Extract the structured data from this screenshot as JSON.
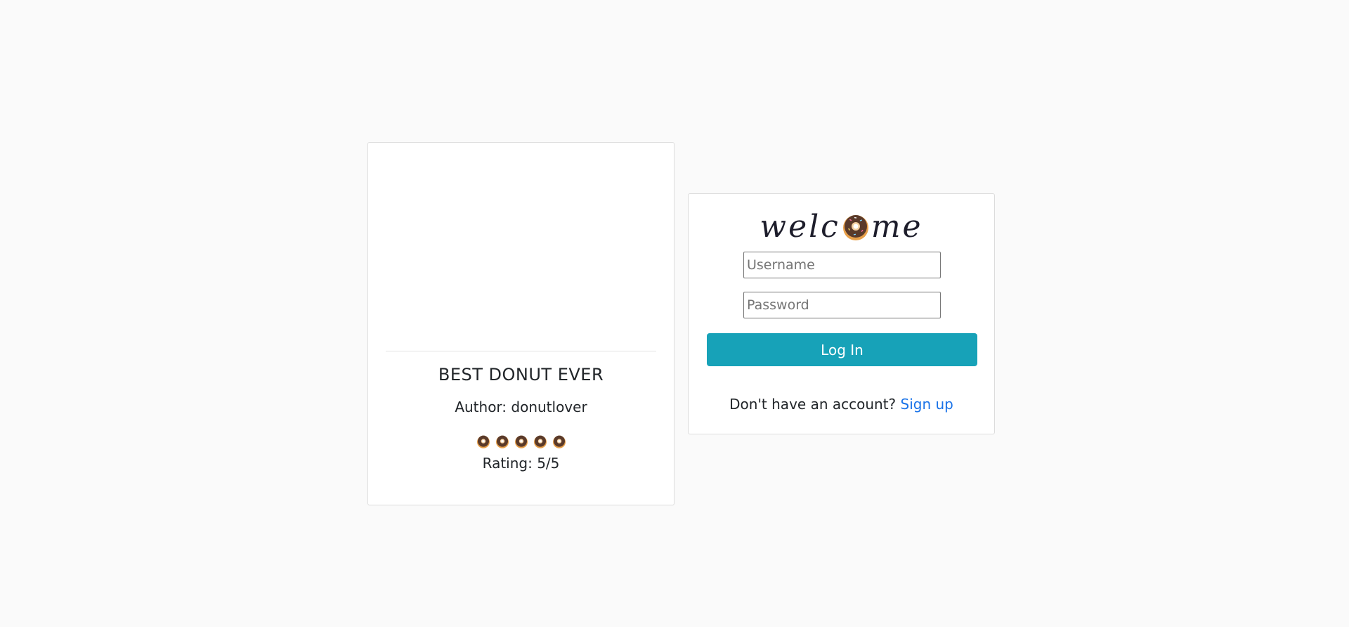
{
  "post": {
    "title": "BEST DONUT EVER",
    "author": "Author: donutlover",
    "rating_value": 5,
    "rating_max": 5,
    "rating_text": "Rating: 5/5",
    "rating_icon": "donut-icon"
  },
  "login": {
    "welcome_prefix": "welc",
    "welcome_suffix": "me",
    "welcome_icon": "donut-icon",
    "username_placeholder": "Username",
    "password_placeholder": "Password",
    "login_label": "Log In",
    "signup_prompt": "Don't have an account?",
    "signup_link": "Sign up"
  },
  "colors": {
    "background": "#fafafa",
    "card": "#ffffff",
    "button": "#17a2b8",
    "link": "#1a73e8",
    "donut_dough": "#e8a04a",
    "donut_frosting": "#5a3a2a"
  }
}
